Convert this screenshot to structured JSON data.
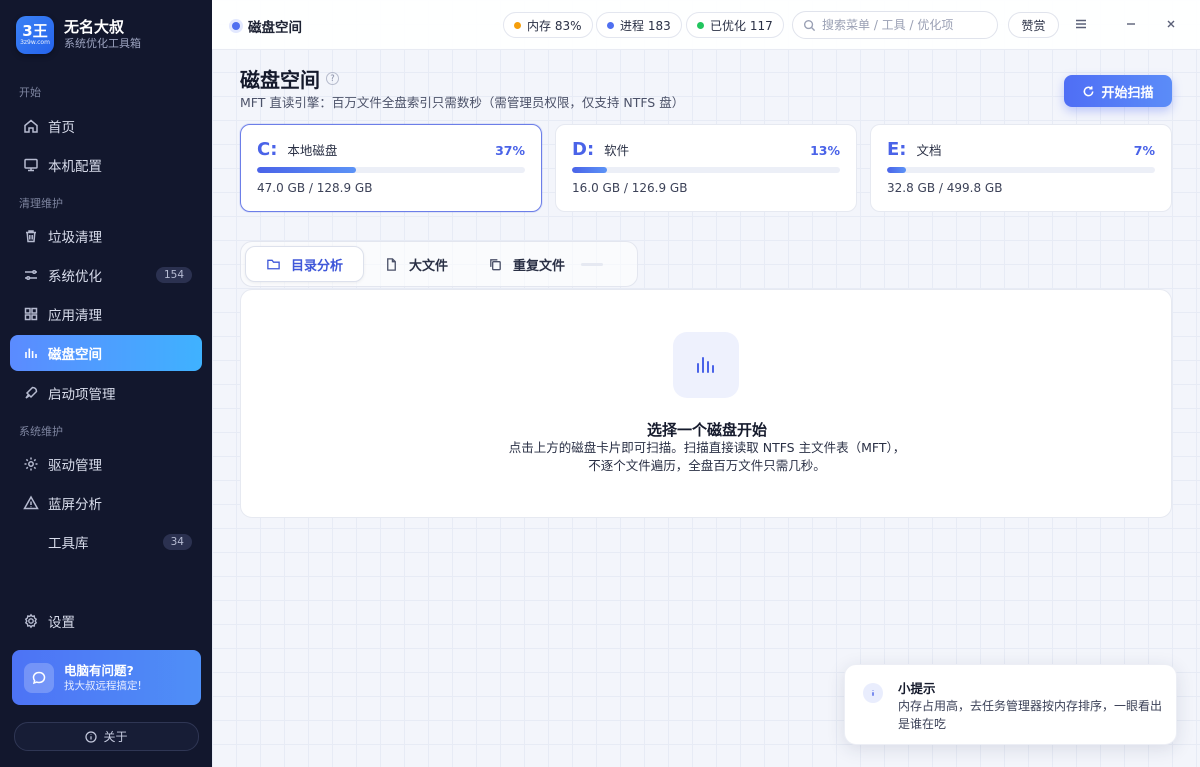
{
  "brand": {
    "logo_main": "3王",
    "logo_sub": "3z9w.com",
    "name": "无名大叔",
    "subtitle": "系统优化工具箱"
  },
  "sidebar": {
    "sections": [
      "开始",
      "清理维护",
      "系统维护"
    ],
    "items": [
      {
        "label": "首页",
        "icon": "home-icon"
      },
      {
        "label": "本机配置",
        "icon": "monitor-icon"
      },
      {
        "label": "垃圾清理",
        "icon": "trash-icon"
      },
      {
        "label": "系统优化",
        "icon": "sliders-icon",
        "badge": "154"
      },
      {
        "label": "应用清理",
        "icon": "grid-icon"
      },
      {
        "label": "磁盘空间",
        "icon": "bar-chart-icon",
        "active": true
      },
      {
        "label": "启动项管理",
        "icon": "rocket-icon"
      },
      {
        "label": "驱动管理",
        "icon": "gear-icon"
      },
      {
        "label": "蓝屏分析",
        "icon": "warning-icon"
      },
      {
        "label": "工具库",
        "badge": "34"
      }
    ],
    "settings_label": "设置",
    "help": {
      "title": "电脑有问题?",
      "subtitle": "找大叔远程搞定!"
    },
    "about_label": "关于"
  },
  "topbar": {
    "breadcrumb": "磁盘空间",
    "status": [
      {
        "label": "内存 83%",
        "color": "#f59e0b"
      },
      {
        "label": "进程 183",
        "color": "#4f6ff0"
      },
      {
        "label": "已优化 117",
        "color": "#22c55e"
      }
    ],
    "search_placeholder": "搜索菜单 / 工具 / 优化项",
    "donate_label": "赞赏"
  },
  "page": {
    "title": "磁盘空间",
    "help_mark": "?",
    "subtitle": "MFT 直读引擎：百万文件全盘索引只需数秒（需管理员权限，仅支持 NTFS 盘）",
    "scan_label": "开始扫描"
  },
  "disks": [
    {
      "letter": "C:",
      "name": "本地磁盘",
      "percent": 37,
      "percent_label": "37%",
      "size": "47.0 GB / 128.9 GB",
      "selected": true
    },
    {
      "letter": "D:",
      "name": "软件",
      "percent": 13,
      "percent_label": "13%",
      "size": "16.0 GB / 126.9 GB",
      "selected": false
    },
    {
      "letter": "E:",
      "name": "文档",
      "percent": 7,
      "percent_label": "7%",
      "size": "32.8 GB / 499.8 GB",
      "selected": false
    }
  ],
  "tabs": [
    {
      "label": "目录分析",
      "active": true
    },
    {
      "label": "大文件",
      "active": false
    },
    {
      "label": "重复文件",
      "active": false
    }
  ],
  "empty_state": {
    "title": "选择一个磁盘开始",
    "line1": "点击上方的磁盘卡片即可扫描。扫描直接读取 NTFS 主文件表（MFT），",
    "line2": "不逐个文件遍历，全盘百万文件只需几秒。"
  },
  "toast": {
    "title": "小提示",
    "text": "内存占用高，去任务管理器按内存排序，一眼看出是谁在吃"
  }
}
